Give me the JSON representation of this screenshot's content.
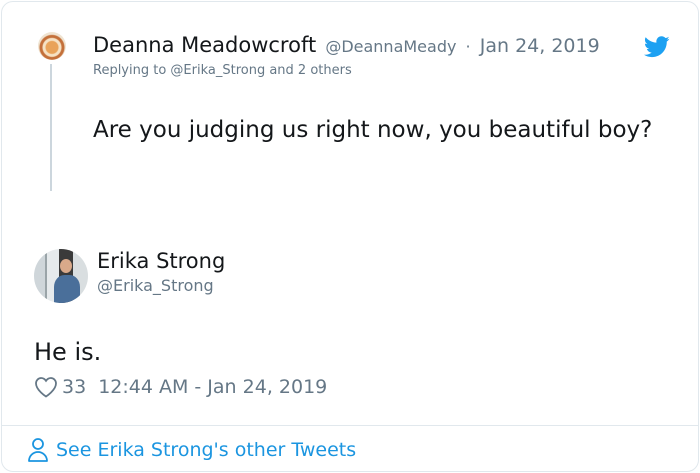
{
  "parent_tweet": {
    "display_name": "Deanna Meadowcroft",
    "handle": "@DeannaMeady",
    "separator": "·",
    "date": "Jan 24, 2019",
    "replying_to": "Replying to @Erika_Strong and 2 others",
    "text": "Are you judging us right now, you beautiful boy?"
  },
  "main_tweet": {
    "display_name": "Erika Strong",
    "handle": "@Erika_Strong",
    "text": "He is.",
    "like_count": "33",
    "timestamp": "12:44 AM - Jan 24, 2019"
  },
  "footer": {
    "see_more_label": "See Erika Strong's other Tweets"
  },
  "icons": {
    "brand": "twitter-bird-icon",
    "like": "heart-icon",
    "profile": "person-icon"
  },
  "colors": {
    "brand_blue": "#1da1f2",
    "link_blue": "#1b95e0",
    "muted_text": "#657786",
    "primary_text": "#14171a",
    "border": "#e1e8ed"
  }
}
